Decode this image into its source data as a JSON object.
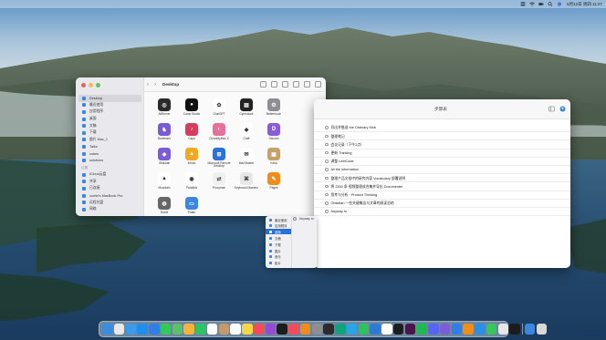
{
  "menubar": {
    "icons": [
      "control-center-icon",
      "wifi-icon",
      "battery-icon",
      "search-icon",
      "siri-icon"
    ],
    "datetime": "6月12日 周四 11:27"
  },
  "finder": {
    "title": "Desktop",
    "sidebar": [
      {
        "type": "head",
        "label": ""
      },
      {
        "type": "item",
        "label": "Desktop",
        "icon": "desktop-icon",
        "active": true
      },
      {
        "type": "item",
        "label": "最近使用",
        "icon": "clock-icon"
      },
      {
        "type": "item",
        "label": "应用程序",
        "icon": "apps-icon"
      },
      {
        "type": "item",
        "label": "桌面",
        "icon": "desktop-icon"
      },
      {
        "type": "item",
        "label": "文稿",
        "icon": "document-icon"
      },
      {
        "type": "item",
        "label": "下载",
        "icon": "download-icon"
      },
      {
        "type": "item",
        "label": "图片 Mac_1",
        "icon": "folder-icon"
      },
      {
        "type": "item",
        "label": "Taiko",
        "icon": "folder-icon"
      },
      {
        "type": "item",
        "label": "cubes",
        "icon": "folder-icon"
      },
      {
        "type": "item",
        "label": "solutions",
        "icon": "folder-icon"
      },
      {
        "type": "head",
        "label": "位置"
      },
      {
        "type": "item",
        "label": "iCloud云盘",
        "icon": "cloud-icon"
      },
      {
        "type": "item",
        "label": "共享",
        "icon": "shared-icon"
      },
      {
        "type": "item",
        "label": "已连接",
        "icon": "network-icon"
      },
      {
        "type": "item",
        "label": "xunlei's MacBook Pro",
        "icon": "laptop-icon"
      },
      {
        "type": "item",
        "label": "远程光盘",
        "icon": "disc-icon"
      },
      {
        "type": "item",
        "label": "网络",
        "icon": "network-icon"
      }
    ],
    "apps": [
      {
        "name": "AltServer",
        "color": "#2b2b2b",
        "glyph": "◎"
      },
      {
        "name": "Camo Studio",
        "color": "#111111",
        "glyph": "●"
      },
      {
        "name": "ChatGPT",
        "color": "#ffffff",
        "glyph": "✿"
      },
      {
        "name": "Cyberduck",
        "color": "#222222",
        "glyph": "▤"
      },
      {
        "name": "Bettertouch",
        "color": "#8e8e93",
        "glyph": "⚙"
      },
      {
        "name": "Bartender",
        "color": "#7a5bd6",
        "glyph": "♞"
      },
      {
        "name": "Capo",
        "color": "#d93b5f",
        "glyph": "♪"
      },
      {
        "name": "CleanMyMac X",
        "color": "#e6709a",
        "glyph": "◐"
      },
      {
        "name": "Craft",
        "color": "#ffffff",
        "glyph": "◆"
      },
      {
        "name": "Discord",
        "color": "#8a5bd9",
        "glyph": "D"
      },
      {
        "name": "Obsidian",
        "color": "#7d5cd6",
        "glyph": "◆"
      },
      {
        "name": "Infuse",
        "color": "#f2a922",
        "glyph": "▲"
      },
      {
        "name": "Microsoft Remote Desktop",
        "color": "#2a72d6",
        "glyph": "⊞"
      },
      {
        "name": "Mail Master",
        "color": "#ffffff",
        "glyph": "✉"
      },
      {
        "name": "Keka",
        "color": "#c7a16a",
        "glyph": "▣"
      },
      {
        "name": "Mountain",
        "color": "#ffffff",
        "glyph": "▲"
      },
      {
        "name": "Parallels",
        "color": "#ffffff",
        "glyph": "◉"
      },
      {
        "name": "Proxyman",
        "color": "#f0f0f0",
        "glyph": "⇄"
      },
      {
        "name": "Keyboard Maestro",
        "color": "#e7e7e7",
        "glyph": "⌘"
      },
      {
        "name": "Pages",
        "color": "#f08c1a",
        "glyph": "✎"
      },
      {
        "name": "Robot",
        "color": "#666666",
        "glyph": "◍"
      },
      {
        "name": "Paste",
        "color": "#3b87e0",
        "glyph": "▭"
      }
    ]
  },
  "doc": {
    "title": "步骤表",
    "lines": [
      "导出并推送 the Ordinary Mob",
      "整理笔记",
      "会议记录（下午2点）",
      "更新 Thinking",
      "调整 LeetCode",
      "All the information",
      "整理产品文档中的研究内容 Vocabulary 部署说明",
      "将 2500 条 视频整理成合集并导出 Documenter",
      "思考与分析 · Product Thinking",
      "Obsidian 一些关键概念与文章的阅读总结",
      "Anyway to"
    ]
  },
  "popmenu": {
    "items": [
      {
        "label": "最近使用",
        "selected": false
      },
      {
        "label": "应用程序",
        "selected": false
      },
      {
        "label": "桌面",
        "selected": true
      },
      {
        "label": "文稿",
        "selected": false
      },
      {
        "label": "下载",
        "selected": false
      },
      {
        "label": "图片",
        "selected": false
      },
      {
        "label": "音乐",
        "selected": false
      },
      {
        "label": "影片",
        "selected": false
      }
    ],
    "side_label": "Anyway to"
  },
  "dock": {
    "apps": [
      {
        "name": "finder-icon",
        "color": "#3b8de0"
      },
      {
        "name": "launchpad-icon",
        "color": "#e8e8e8"
      },
      {
        "name": "safari-icon",
        "color": "#3a9be8"
      },
      {
        "name": "app-store-icon",
        "color": "#1f8ef0"
      },
      {
        "name": "mail-icon",
        "color": "#2f7fe8"
      },
      {
        "name": "messages-icon",
        "color": "#34c759"
      },
      {
        "name": "maps-icon",
        "color": "#5cbf6a"
      },
      {
        "name": "photos-icon",
        "color": "#f5b33c"
      },
      {
        "name": "facetime-icon",
        "color": "#2cc36b"
      },
      {
        "name": "calendar-icon",
        "color": "#ffffff"
      },
      {
        "name": "contacts-icon",
        "color": "#c39a6b"
      },
      {
        "name": "reminders-icon",
        "color": "#ffffff"
      },
      {
        "name": "notes-icon",
        "color": "#f7d54a"
      },
      {
        "name": "music-icon",
        "color": "#f24c5c"
      },
      {
        "name": "podcasts-icon",
        "color": "#9a47d9"
      },
      {
        "name": "tv-icon",
        "color": "#1c1c1e"
      },
      {
        "name": "news-icon",
        "color": "#f24c5c"
      },
      {
        "name": "books-icon",
        "color": "#f08c1a"
      },
      {
        "name": "system-preferences-icon",
        "color": "#8e8e93"
      },
      {
        "name": "terminal-icon",
        "color": "#2b2b2b"
      },
      {
        "name": "chatgpt-icon",
        "color": "#10a37f"
      },
      {
        "name": "telegram-icon",
        "color": "#2aa4e8"
      },
      {
        "name": "wechat-icon",
        "color": "#2dc35a"
      },
      {
        "name": "vscode-icon",
        "color": "#2a7bd6"
      },
      {
        "name": "notion-icon",
        "color": "#ffffff"
      },
      {
        "name": "figma-icon",
        "color": "#1e1e1e"
      },
      {
        "name": "slack-icon",
        "color": "#4a154b"
      },
      {
        "name": "spotify-icon",
        "color": "#1db954"
      },
      {
        "name": "discord-icon",
        "color": "#5865f2"
      },
      {
        "name": "obsidian-icon",
        "color": "#7d5cd6"
      },
      {
        "name": "xcode-icon",
        "color": "#2f7fe8"
      },
      {
        "name": "pages-icon",
        "color": "#f08c1a"
      },
      {
        "name": "keynote-icon",
        "color": "#2a8fe8"
      },
      {
        "name": "numbers-icon",
        "color": "#34c759"
      },
      {
        "name": "preview-icon",
        "color": "#e7e7e7"
      },
      {
        "name": "activity-monitor-icon",
        "color": "#1c1c1e"
      }
    ],
    "trailing": [
      {
        "name": "downloads-stack-icon",
        "color": "#3b87e0"
      },
      {
        "name": "trash-icon",
        "color": "#d8d8d8"
      }
    ]
  }
}
